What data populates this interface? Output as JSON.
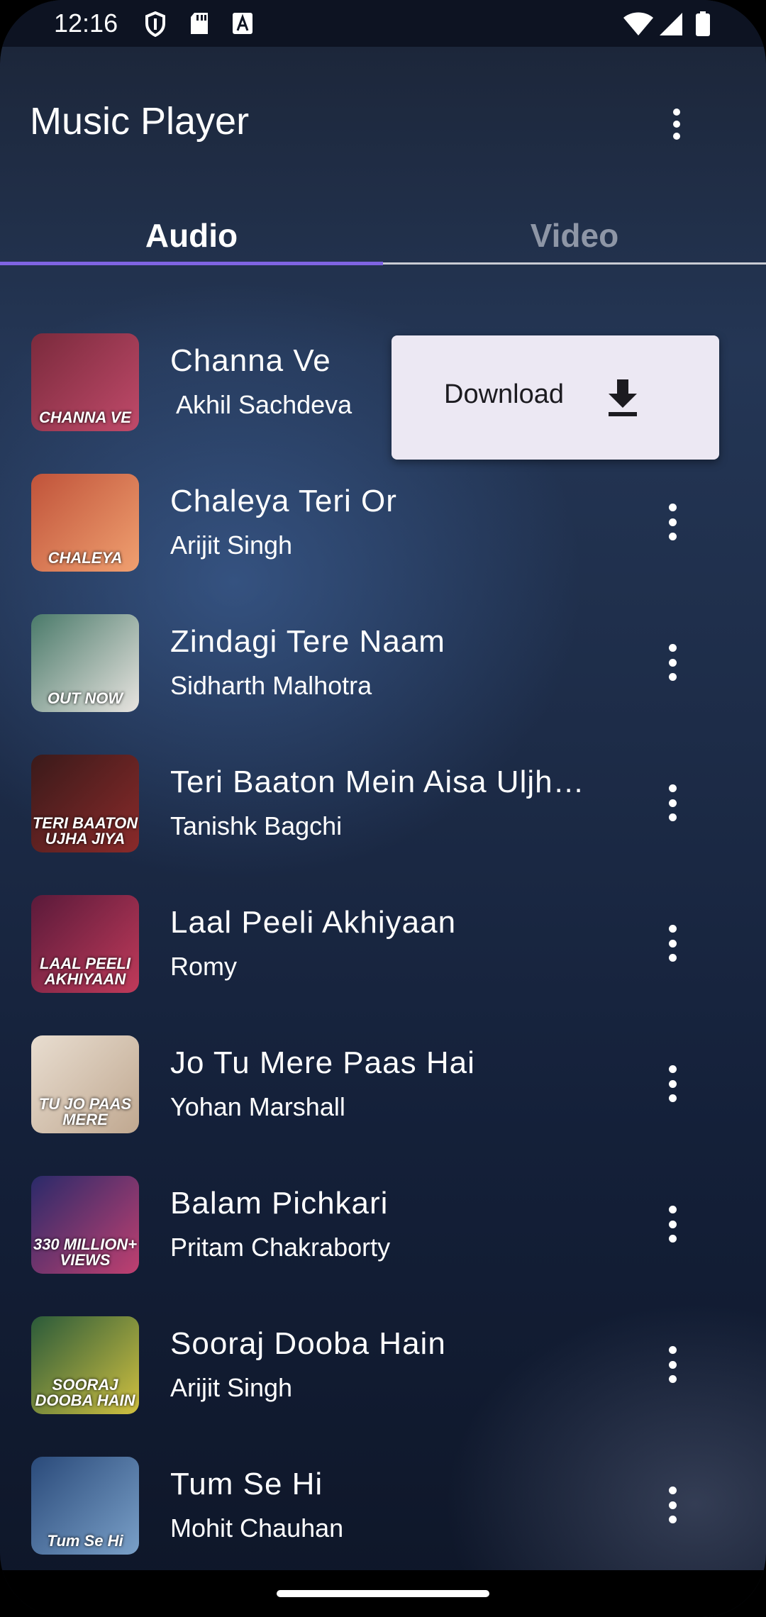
{
  "status_bar": {
    "time": "12:16",
    "left_icons": [
      "shield-icon",
      "sd-card-icon",
      "font-a-icon"
    ],
    "right_icons": [
      "wifi-icon",
      "signal-icon",
      "battery-icon"
    ]
  },
  "app_bar": {
    "title": "Music Player",
    "menu_icon": "more-vert-icon"
  },
  "tabs": [
    {
      "label": "Audio",
      "selected": true
    },
    {
      "label": "Video",
      "selected": false
    }
  ],
  "colors": {
    "tab_indicator": "#7f64e2",
    "popup_bg": "#ece8f3",
    "inactive_tab": "#8e96a6"
  },
  "songs": [
    {
      "title": "Channa Ve",
      "artist": " Akhil Sachdeva",
      "thumb_caption": "CHANNA VE",
      "thumb_colors": [
        "#7a2a3c",
        "#c04a6a"
      ]
    },
    {
      "title": "Chaleya Teri Or",
      "artist": "Arijit Singh",
      "thumb_caption": "CHALEYA",
      "thumb_colors": [
        "#c0533a",
        "#f0a070"
      ]
    },
    {
      "title": "Zindagi Tere Naam",
      "artist": "Sidharth Malhotra",
      "thumb_caption": "OUT NOW",
      "thumb_colors": [
        "#4a7a6a",
        "#e8e4e0"
      ]
    },
    {
      "title": "Teri Baaton Mein Aisa Uljha Jiya",
      "artist": "Tanishk Bagchi",
      "thumb_caption": "TERI BAATON UJHA JIYA",
      "thumb_colors": [
        "#3a1a1a",
        "#8a2a2a"
      ]
    },
    {
      "title": "Laal Peeli Akhiyaan",
      "artist": "Romy",
      "thumb_caption": "LAAL PEELI AKHIYAAN",
      "thumb_colors": [
        "#5a1a3a",
        "#c03a5a"
      ]
    },
    {
      "title": "Jo Tu Mere Paas Hai",
      "artist": "Yohan Marshall",
      "thumb_caption": "TU JO PAAS MERE",
      "thumb_colors": [
        "#e8ddd0",
        "#c0a890"
      ]
    },
    {
      "title": "Balam Pichkari",
      "artist": "Pritam Chakraborty",
      "thumb_caption": "330 MILLION+ VIEWS",
      "thumb_colors": [
        "#2a2a6a",
        "#c04070"
      ]
    },
    {
      "title": "Sooraj Dooba Hain",
      "artist": "Arijit Singh",
      "thumb_caption": "SOORAJ DOOBA HAIN",
      "thumb_colors": [
        "#2a5a3a",
        "#d0c040"
      ]
    },
    {
      "title": "Tum Se Hi",
      "artist": "Mohit Chauhan",
      "thumb_caption": "Tum Se Hi",
      "thumb_colors": [
        "#2a4a7a",
        "#7aa0c8"
      ]
    }
  ],
  "popup": {
    "label": "Download",
    "icon": "download-icon"
  }
}
